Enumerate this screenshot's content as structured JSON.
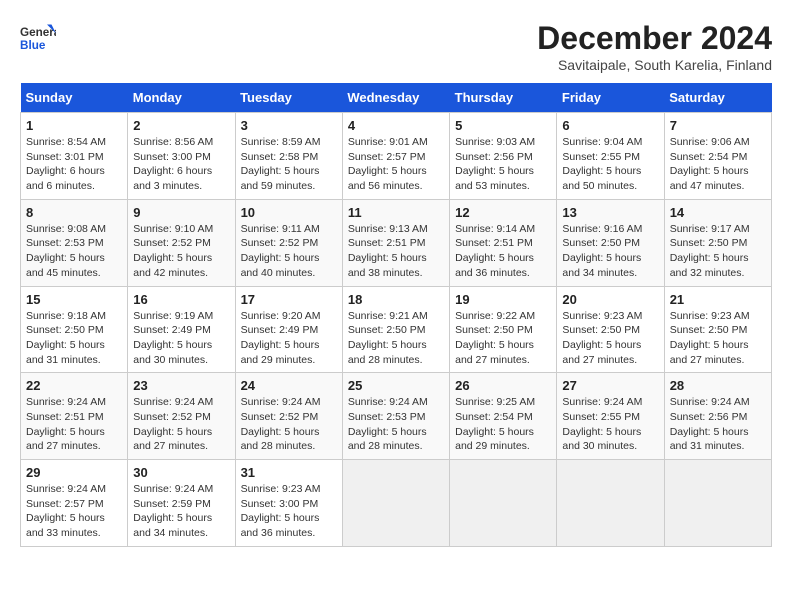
{
  "header": {
    "logo_general": "General",
    "logo_blue": "Blue",
    "title": "December 2024",
    "subtitle": "Savitaipale, South Karelia, Finland"
  },
  "columns": [
    "Sunday",
    "Monday",
    "Tuesday",
    "Wednesday",
    "Thursday",
    "Friday",
    "Saturday"
  ],
  "weeks": [
    [
      {
        "day": "1",
        "sunrise": "Sunrise: 8:54 AM",
        "sunset": "Sunset: 3:01 PM",
        "daylight": "Daylight: 6 hours and 6 minutes."
      },
      {
        "day": "2",
        "sunrise": "Sunrise: 8:56 AM",
        "sunset": "Sunset: 3:00 PM",
        "daylight": "Daylight: 6 hours and 3 minutes."
      },
      {
        "day": "3",
        "sunrise": "Sunrise: 8:59 AM",
        "sunset": "Sunset: 2:58 PM",
        "daylight": "Daylight: 5 hours and 59 minutes."
      },
      {
        "day": "4",
        "sunrise": "Sunrise: 9:01 AM",
        "sunset": "Sunset: 2:57 PM",
        "daylight": "Daylight: 5 hours and 56 minutes."
      },
      {
        "day": "5",
        "sunrise": "Sunrise: 9:03 AM",
        "sunset": "Sunset: 2:56 PM",
        "daylight": "Daylight: 5 hours and 53 minutes."
      },
      {
        "day": "6",
        "sunrise": "Sunrise: 9:04 AM",
        "sunset": "Sunset: 2:55 PM",
        "daylight": "Daylight: 5 hours and 50 minutes."
      },
      {
        "day": "7",
        "sunrise": "Sunrise: 9:06 AM",
        "sunset": "Sunset: 2:54 PM",
        "daylight": "Daylight: 5 hours and 47 minutes."
      }
    ],
    [
      {
        "day": "8",
        "sunrise": "Sunrise: 9:08 AM",
        "sunset": "Sunset: 2:53 PM",
        "daylight": "Daylight: 5 hours and 45 minutes."
      },
      {
        "day": "9",
        "sunrise": "Sunrise: 9:10 AM",
        "sunset": "Sunset: 2:52 PM",
        "daylight": "Daylight: 5 hours and 42 minutes."
      },
      {
        "day": "10",
        "sunrise": "Sunrise: 9:11 AM",
        "sunset": "Sunset: 2:52 PM",
        "daylight": "Daylight: 5 hours and 40 minutes."
      },
      {
        "day": "11",
        "sunrise": "Sunrise: 9:13 AM",
        "sunset": "Sunset: 2:51 PM",
        "daylight": "Daylight: 5 hours and 38 minutes."
      },
      {
        "day": "12",
        "sunrise": "Sunrise: 9:14 AM",
        "sunset": "Sunset: 2:51 PM",
        "daylight": "Daylight: 5 hours and 36 minutes."
      },
      {
        "day": "13",
        "sunrise": "Sunrise: 9:16 AM",
        "sunset": "Sunset: 2:50 PM",
        "daylight": "Daylight: 5 hours and 34 minutes."
      },
      {
        "day": "14",
        "sunrise": "Sunrise: 9:17 AM",
        "sunset": "Sunset: 2:50 PM",
        "daylight": "Daylight: 5 hours and 32 minutes."
      }
    ],
    [
      {
        "day": "15",
        "sunrise": "Sunrise: 9:18 AM",
        "sunset": "Sunset: 2:50 PM",
        "daylight": "Daylight: 5 hours and 31 minutes."
      },
      {
        "day": "16",
        "sunrise": "Sunrise: 9:19 AM",
        "sunset": "Sunset: 2:49 PM",
        "daylight": "Daylight: 5 hours and 30 minutes."
      },
      {
        "day": "17",
        "sunrise": "Sunrise: 9:20 AM",
        "sunset": "Sunset: 2:49 PM",
        "daylight": "Daylight: 5 hours and 29 minutes."
      },
      {
        "day": "18",
        "sunrise": "Sunrise: 9:21 AM",
        "sunset": "Sunset: 2:50 PM",
        "daylight": "Daylight: 5 hours and 28 minutes."
      },
      {
        "day": "19",
        "sunrise": "Sunrise: 9:22 AM",
        "sunset": "Sunset: 2:50 PM",
        "daylight": "Daylight: 5 hours and 27 minutes."
      },
      {
        "day": "20",
        "sunrise": "Sunrise: 9:23 AM",
        "sunset": "Sunset: 2:50 PM",
        "daylight": "Daylight: 5 hours and 27 minutes."
      },
      {
        "day": "21",
        "sunrise": "Sunrise: 9:23 AM",
        "sunset": "Sunset: 2:50 PM",
        "daylight": "Daylight: 5 hours and 27 minutes."
      }
    ],
    [
      {
        "day": "22",
        "sunrise": "Sunrise: 9:24 AM",
        "sunset": "Sunset: 2:51 PM",
        "daylight": "Daylight: 5 hours and 27 minutes."
      },
      {
        "day": "23",
        "sunrise": "Sunrise: 9:24 AM",
        "sunset": "Sunset: 2:52 PM",
        "daylight": "Daylight: 5 hours and 27 minutes."
      },
      {
        "day": "24",
        "sunrise": "Sunrise: 9:24 AM",
        "sunset": "Sunset: 2:52 PM",
        "daylight": "Daylight: 5 hours and 28 minutes."
      },
      {
        "day": "25",
        "sunrise": "Sunrise: 9:24 AM",
        "sunset": "Sunset: 2:53 PM",
        "daylight": "Daylight: 5 hours and 28 minutes."
      },
      {
        "day": "26",
        "sunrise": "Sunrise: 9:25 AM",
        "sunset": "Sunset: 2:54 PM",
        "daylight": "Daylight: 5 hours and 29 minutes."
      },
      {
        "day": "27",
        "sunrise": "Sunrise: 9:24 AM",
        "sunset": "Sunset: 2:55 PM",
        "daylight": "Daylight: 5 hours and 30 minutes."
      },
      {
        "day": "28",
        "sunrise": "Sunrise: 9:24 AM",
        "sunset": "Sunset: 2:56 PM",
        "daylight": "Daylight: 5 hours and 31 minutes."
      }
    ],
    [
      {
        "day": "29",
        "sunrise": "Sunrise: 9:24 AM",
        "sunset": "Sunset: 2:57 PM",
        "daylight": "Daylight: 5 hours and 33 minutes."
      },
      {
        "day": "30",
        "sunrise": "Sunrise: 9:24 AM",
        "sunset": "Sunset: 2:59 PM",
        "daylight": "Daylight: 5 hours and 34 minutes."
      },
      {
        "day": "31",
        "sunrise": "Sunrise: 9:23 AM",
        "sunset": "Sunset: 3:00 PM",
        "daylight": "Daylight: 5 hours and 36 minutes."
      },
      null,
      null,
      null,
      null
    ]
  ]
}
